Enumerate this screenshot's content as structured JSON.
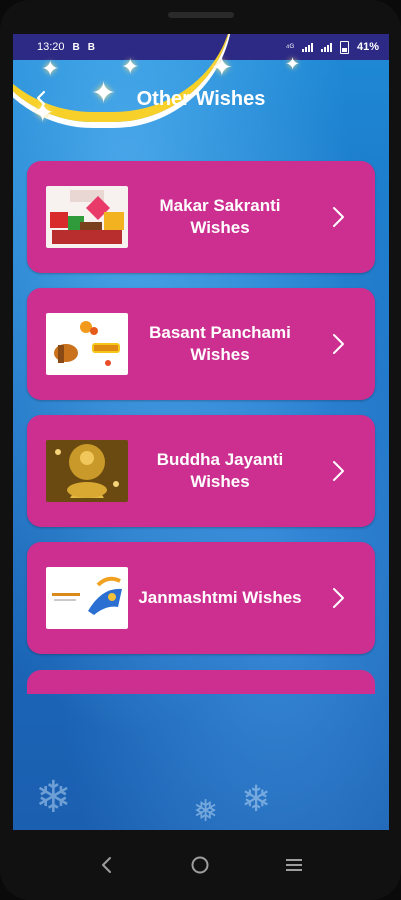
{
  "status_bar": {
    "time": "13:20",
    "icon_b1": "B",
    "icon_b2": "B",
    "battery_percent": "41%"
  },
  "header": {
    "title": "Other Wishes"
  },
  "items": [
    {
      "label": "Makar Sakranti Wishes",
      "thumb": "makar-sakranti-image"
    },
    {
      "label": "Basant Panchami Wishes",
      "thumb": "basant-panchami-image"
    },
    {
      "label": "Buddha Jayanti Wishes",
      "thumb": "buddha-jayanti-image"
    },
    {
      "label": "Janmashtmi Wishes",
      "thumb": "janmashtmi-image"
    }
  ],
  "colors": {
    "status_bar": "#2d2a86",
    "card": "#cc2f90",
    "background": "#1a6ec0"
  }
}
